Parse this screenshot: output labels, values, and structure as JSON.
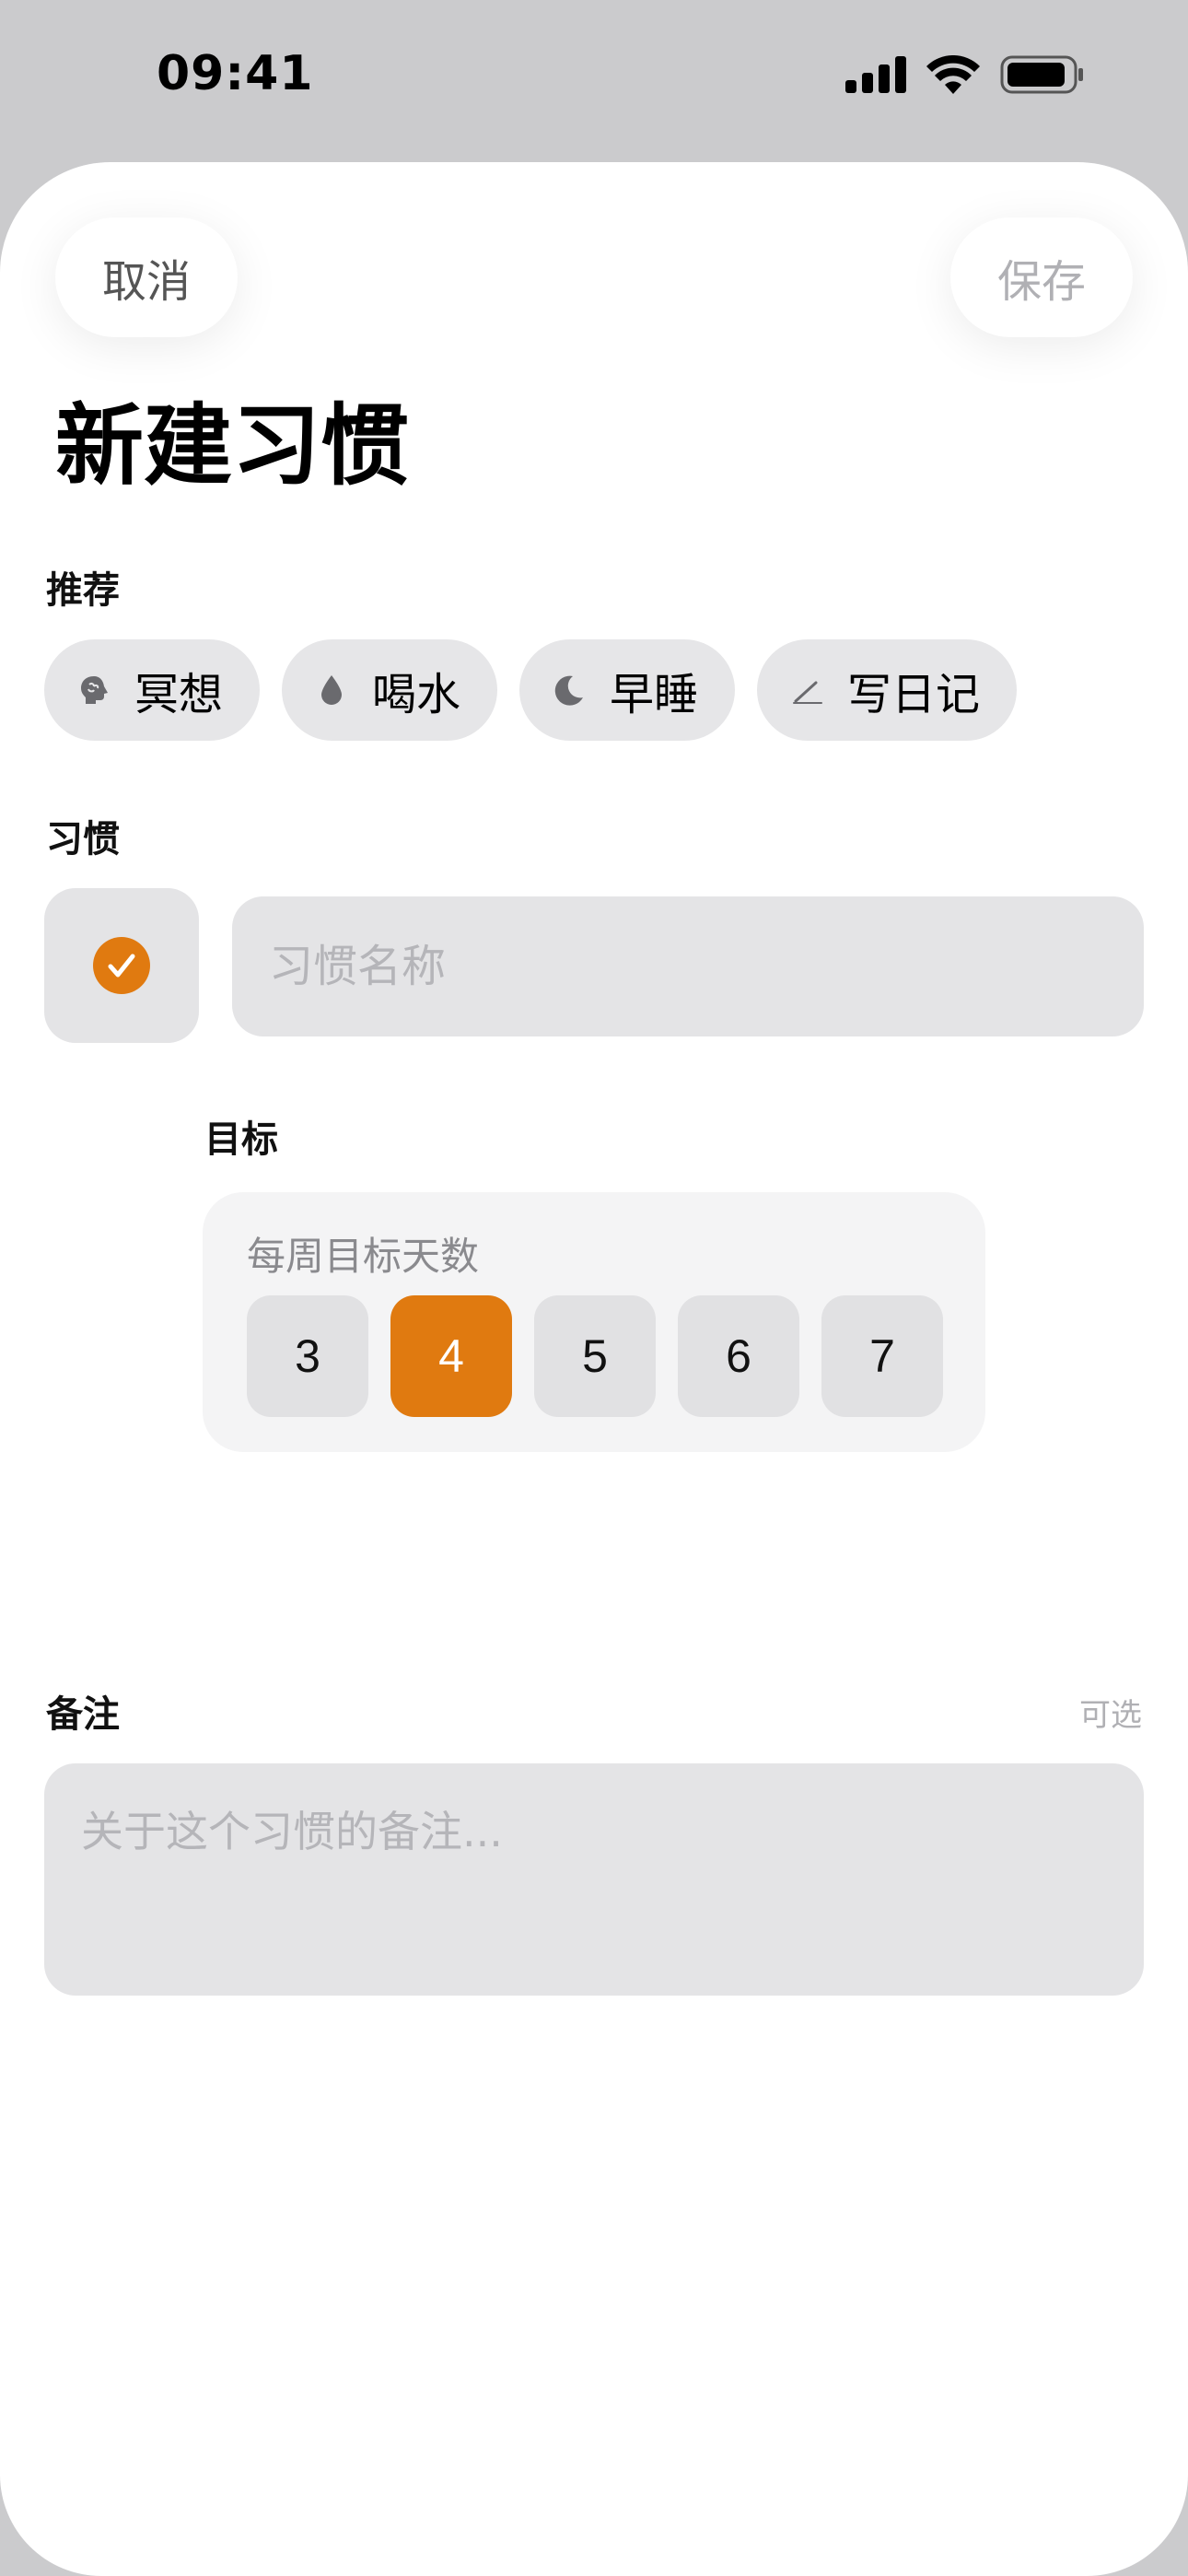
{
  "status_bar": {
    "time": "09:41"
  },
  "nav": {
    "cancel_label": "取消",
    "save_label": "保存"
  },
  "page_title": "新建习惯",
  "recommend": {
    "label": "推荐",
    "chips": [
      {
        "label": "冥想",
        "icon": "brain-icon"
      },
      {
        "label": "喝水",
        "icon": "droplet-icon"
      },
      {
        "label": "早睡",
        "icon": "moon-icon"
      },
      {
        "label": "写日记",
        "icon": "pencil-icon"
      }
    ]
  },
  "habit": {
    "label": "习惯",
    "icon": "checkmark-circle-icon",
    "name_placeholder": "习惯名称",
    "accent_color": "#e07a10"
  },
  "goal": {
    "label": "目标",
    "subtitle": "每周目标天数",
    "days": [
      "3",
      "4",
      "5",
      "6",
      "7"
    ],
    "selected": "4"
  },
  "notes": {
    "label": "备注",
    "optional_label": "可选",
    "placeholder": "关于这个习惯的备注..."
  }
}
